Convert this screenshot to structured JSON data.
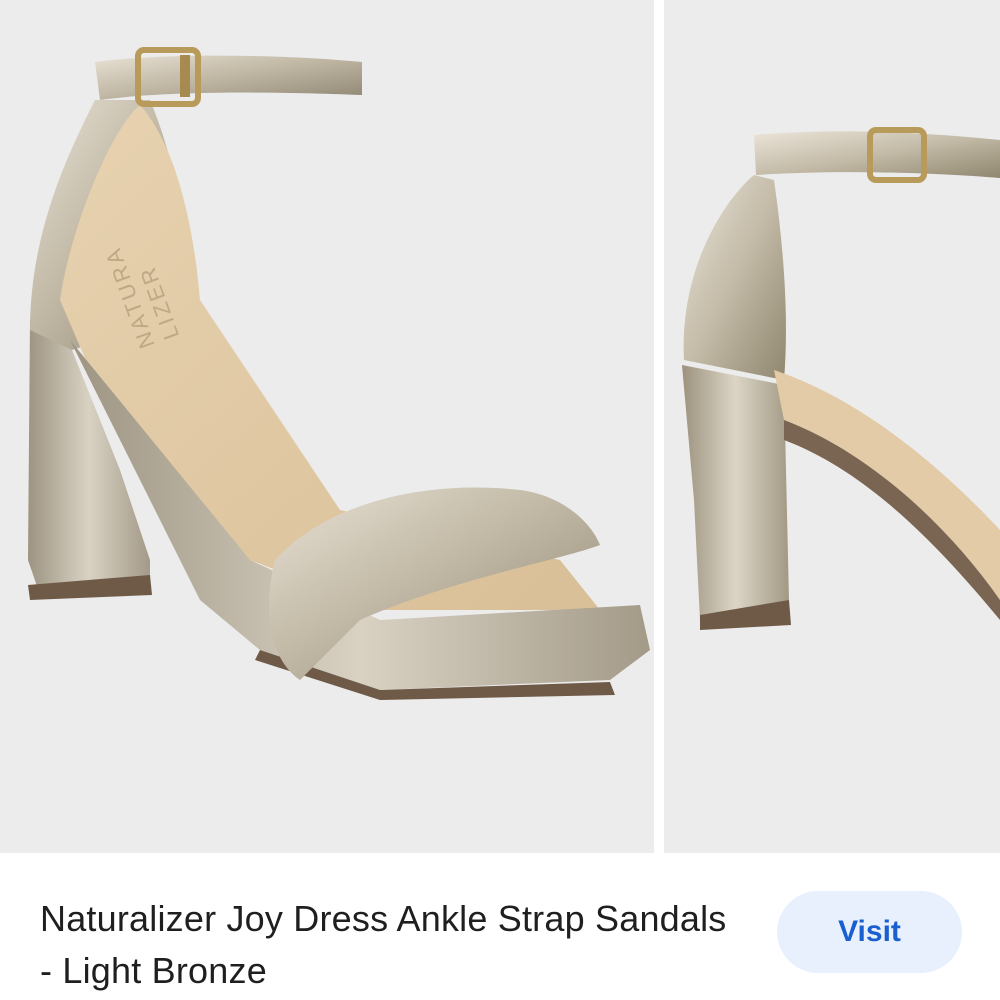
{
  "result": {
    "title": "Naturalizer Joy Dress Ankle Strap Sandals - Light Bronze",
    "visit_label": "Visit"
  },
  "gallery": {
    "images": [
      {
        "subject": "sandal-side-view",
        "brand_mark": "NATURALIZER"
      },
      {
        "subject": "sandal-heel-detail"
      }
    ]
  }
}
